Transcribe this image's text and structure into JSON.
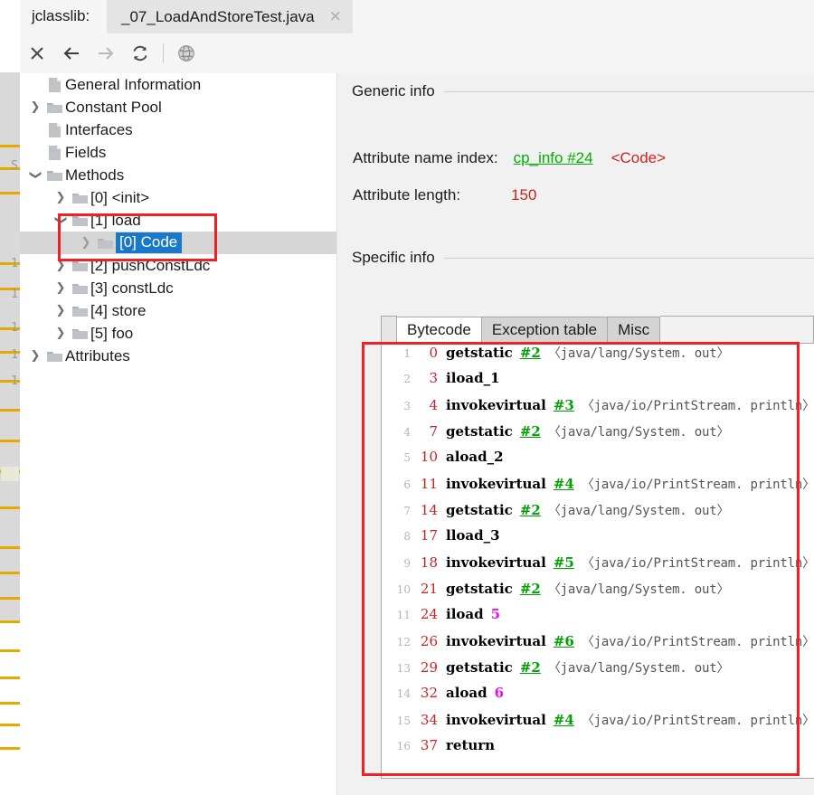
{
  "titlebar": {
    "app_label": "jclasslib:",
    "document_tab": "_07_LoadAndStoreTest.java",
    "close_glyph": "×"
  },
  "toolbar": {
    "buttons": [
      {
        "name": "close-icon",
        "glyph": "✕",
        "state": "enabled"
      },
      {
        "name": "back-icon",
        "glyph": "←",
        "state": "enabled"
      },
      {
        "name": "forward-icon",
        "glyph": "→",
        "state": "disabled"
      },
      {
        "name": "reload-icon",
        "glyph": "↻",
        "state": "enabled"
      },
      {
        "name": "browse-icon",
        "glyph": "●",
        "state": "enabled"
      }
    ]
  },
  "tree": {
    "items": [
      {
        "label": "General Information",
        "indent": 0,
        "icon": "file",
        "twisty": "none",
        "selected": false
      },
      {
        "label": "Constant Pool",
        "indent": 0,
        "icon": "folder",
        "twisty": "closed",
        "selected": false
      },
      {
        "label": "Interfaces",
        "indent": 0,
        "icon": "file",
        "twisty": "none",
        "selected": false
      },
      {
        "label": "Fields",
        "indent": 0,
        "icon": "file",
        "twisty": "none",
        "selected": false
      },
      {
        "label": "Methods",
        "indent": 0,
        "icon": "folder",
        "twisty": "open",
        "selected": false
      },
      {
        "label": "[0] <init>",
        "indent": 1,
        "icon": "folder",
        "twisty": "closed",
        "selected": false
      },
      {
        "label": "[1] load",
        "indent": 1,
        "icon": "folder",
        "twisty": "open",
        "selected": false
      },
      {
        "label": "[0] Code",
        "indent": 2,
        "icon": "folder",
        "twisty": "closed-dim",
        "selected": true
      },
      {
        "label": "[2] pushConstLdc",
        "indent": 1,
        "icon": "folder",
        "twisty": "closed",
        "selected": false
      },
      {
        "label": "[3] constLdc",
        "indent": 1,
        "icon": "folder",
        "twisty": "closed",
        "selected": false
      },
      {
        "label": "[4] store",
        "indent": 1,
        "icon": "folder",
        "twisty": "closed",
        "selected": false
      },
      {
        "label": "[5] foo",
        "indent": 1,
        "icon": "folder",
        "twisty": "closed",
        "selected": false
      },
      {
        "label": "Attributes",
        "indent": 0,
        "icon": "folder",
        "twisty": "closed",
        "selected": false
      }
    ],
    "twisty_closed_glyph": "❯",
    "twisty_open_glyph": "❯"
  },
  "detail": {
    "generic_info_title": "Generic info",
    "specific_info_title": "Specific info",
    "fields": [
      {
        "label": "Attribute name index:",
        "link": "cp_info #24",
        "extra": "<Code>"
      },
      {
        "label": "Attribute length:",
        "link": "",
        "extra": "150"
      }
    ],
    "attribute_name_index_label": "Attribute name index:",
    "attribute_name_index_link": "cp_info #24",
    "attribute_name_index_value": "<Code>",
    "attribute_length_label": "Attribute length:",
    "attribute_length_value": "150"
  },
  "tabs": [
    {
      "label": "Bytecode",
      "active": true
    },
    {
      "label": "Exception table",
      "active": false
    },
    {
      "label": "Misc",
      "active": false
    }
  ],
  "bytecode": {
    "lines": [
      {
        "n": "1",
        "offset": "0",
        "mnemonic": "getstatic",
        "cpref": "#2",
        "imm": "",
        "verbose": "〈java/lang/System. out〉"
      },
      {
        "n": "2",
        "offset": "3",
        "mnemonic": "iload_1",
        "cpref": "",
        "imm": "",
        "verbose": ""
      },
      {
        "n": "3",
        "offset": "4",
        "mnemonic": "invokevirtual",
        "cpref": "#3",
        "imm": "",
        "verbose": "〈java/io/PrintStream. println〉"
      },
      {
        "n": "4",
        "offset": "7",
        "mnemonic": "getstatic",
        "cpref": "#2",
        "imm": "",
        "verbose": "〈java/lang/System. out〉"
      },
      {
        "n": "5",
        "offset": "10",
        "mnemonic": "aload_2",
        "cpref": "",
        "imm": "",
        "verbose": ""
      },
      {
        "n": "6",
        "offset": "11",
        "mnemonic": "invokevirtual",
        "cpref": "#4",
        "imm": "",
        "verbose": "〈java/io/PrintStream. println〉"
      },
      {
        "n": "7",
        "offset": "14",
        "mnemonic": "getstatic",
        "cpref": "#2",
        "imm": "",
        "verbose": "〈java/lang/System. out〉"
      },
      {
        "n": "8",
        "offset": "17",
        "mnemonic": "lload_3",
        "cpref": "",
        "imm": "",
        "verbose": ""
      },
      {
        "n": "9",
        "offset": "18",
        "mnemonic": "invokevirtual",
        "cpref": "#5",
        "imm": "",
        "verbose": "〈java/io/PrintStream. println〉"
      },
      {
        "n": "10",
        "offset": "21",
        "mnemonic": "getstatic",
        "cpref": "#2",
        "imm": "",
        "verbose": "〈java/lang/System. out〉"
      },
      {
        "n": "11",
        "offset": "24",
        "mnemonic": "iload",
        "cpref": "",
        "imm": "5",
        "verbose": ""
      },
      {
        "n": "12",
        "offset": "26",
        "mnemonic": "invokevirtual",
        "cpref": "#6",
        "imm": "",
        "verbose": "〈java/io/PrintStream. println〉"
      },
      {
        "n": "13",
        "offset": "29",
        "mnemonic": "getstatic",
        "cpref": "#2",
        "imm": "",
        "verbose": "〈java/lang/System. out〉"
      },
      {
        "n": "14",
        "offset": "32",
        "mnemonic": "aload",
        "cpref": "",
        "imm": "6",
        "verbose": ""
      },
      {
        "n": "15",
        "offset": "34",
        "mnemonic": "invokevirtual",
        "cpref": "#4",
        "imm": "",
        "verbose": "〈java/io/PrintStream. println〉"
      },
      {
        "n": "16",
        "offset": "37",
        "mnemonic": "return",
        "cpref": "",
        "imm": "",
        "verbose": ""
      }
    ]
  },
  "colors": {
    "selection_blue": "#1978c8",
    "link_green": "#00b000",
    "value_red": "#cc2222",
    "immediate_magenta": "#e612e6",
    "annotation_red": "#ee2222",
    "marker_orange": "#e5a900"
  }
}
